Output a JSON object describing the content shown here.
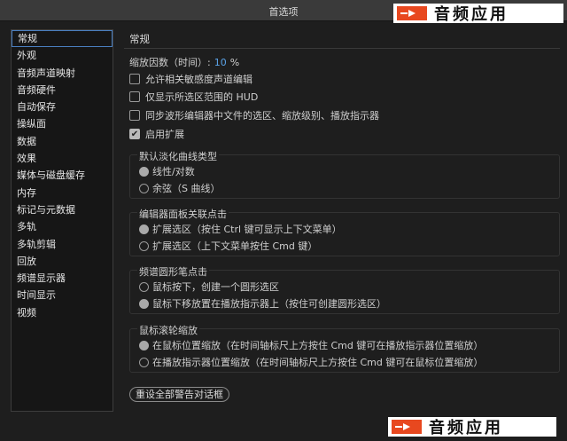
{
  "window": {
    "title": "首选项"
  },
  "logo": {
    "text": "音频应用"
  },
  "sidebar": {
    "items": [
      {
        "label": "常规",
        "selected": true
      },
      {
        "label": "外观"
      },
      {
        "label": "音频声道映射"
      },
      {
        "label": "音频硬件"
      },
      {
        "label": "自动保存"
      },
      {
        "label": "操纵面"
      },
      {
        "label": "数据"
      },
      {
        "label": "效果"
      },
      {
        "label": "媒体与磁盘缓存"
      },
      {
        "label": "内存"
      },
      {
        "label": "标记与元数据"
      },
      {
        "label": "多轨"
      },
      {
        "label": "多轨剪辑"
      },
      {
        "label": "回放"
      },
      {
        "label": "频谱显示器"
      },
      {
        "label": "时间显示"
      },
      {
        "label": "视频"
      }
    ]
  },
  "general": {
    "heading": "常规",
    "zoom": {
      "label": "缩放因数（时间）:",
      "value": "10",
      "unit": "%"
    },
    "checks": [
      {
        "label": "允许相关敏感度声道编辑",
        "checked": false
      },
      {
        "label": "仅显示所选区范围的 HUD",
        "checked": false
      },
      {
        "label": "同步波形编辑器中文件的选区、缩放级别、播放指示器",
        "checked": false
      },
      {
        "label": "启用扩展",
        "checked": true
      }
    ],
    "fade_group": {
      "title": "默认淡化曲线类型",
      "options": [
        {
          "label": "线性/对数",
          "selected": true
        },
        {
          "label": "余弦（S 曲线）",
          "selected": false
        }
      ]
    },
    "editor_group": {
      "title": "编辑器面板关联点击",
      "options": [
        {
          "label": "扩展选区（按住 Ctrl 键可显示上下文菜单）",
          "selected": true
        },
        {
          "label": "扩展选区（上下文菜单按住 Cmd 键）",
          "selected": false
        }
      ]
    },
    "spectral_group": {
      "title": "频谱圆形笔点击",
      "options": [
        {
          "label": "鼠标按下，创建一个圆形选区",
          "selected": false
        },
        {
          "label": "鼠标下移放置在播放指示器上（按住可创建圆形选区）",
          "selected": true
        }
      ]
    },
    "wheel_group": {
      "title": "鼠标滚轮缩放",
      "options": [
        {
          "label": "在鼠标位置缩放（在时间轴标尺上方按住 Cmd 键可在播放指示器位置缩放）",
          "selected": true
        },
        {
          "label": "在播放指示器位置缩放（在时间轴标尺上方按住 Cmd 键可在鼠标位置缩放）",
          "selected": false
        }
      ]
    },
    "reset_button": "重设全部警告对话框"
  }
}
